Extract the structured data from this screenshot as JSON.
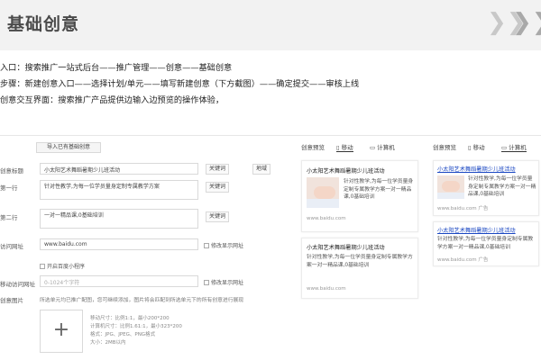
{
  "header": {
    "title": "基础创意"
  },
  "intro": {
    "entry": "入口：搜索推广一站式后台——推广管理——创意——基础创意",
    "steps": "步骤：新建创意入口——选择计划/单元——填写新建创意（下方截图）——确定提交——审核上线",
    "interface": "创意交互界面：搜索推广产品提供边输入边预览的操作体验，"
  },
  "form": {
    "import_button": "导入已有基础创意",
    "title_label": "创意标题",
    "title_value": "小太阳艺术舞蹈暑期少儿班活动",
    "line1_label": "第一行",
    "line1_value": "针对性教学,为每一位学员量身定制专属教学方案",
    "line2_label": "第二行",
    "line2_value": "一对一精品课,0基础培训",
    "visit_url_label": "访问网址",
    "visit_url_value": "www.baidu.com",
    "mobile_landing_checkbox": "开启百度小程序",
    "mobile_url_label": "移动访问网址",
    "mobile_url_placeholder": "0-1024个字符",
    "image_label": "创意图片",
    "image_hint": "所选单元均已推广配图，您可继续添加，图片将会匹配到所选单元下的所有创意进行展现",
    "keyword_button": "关键词",
    "region_button": "地域",
    "modify_display_url": "修改显示网址",
    "upload_icon": "plus-icon",
    "specs": [
      "移动尺寸：比例1:1，最小200*200",
      "计算机尺寸：比例1.61:1，最小323*200",
      "格式：JPG、JPEG、PNG格式",
      "大小：2MB以内"
    ]
  },
  "preview_left": {
    "label": "创意预览",
    "tab_mobile": "移动",
    "tab_pc": "计算机",
    "card1": {
      "title": "小太阳艺术舞蹈暑期少儿班活动",
      "desc": "针对性教学,为每一位学员量身定制专属教学方案一对一精品课,0基础培训",
      "url": "www.baidu.com"
    },
    "card2": {
      "title": "小太阳艺术舞蹈暑期少儿班活动",
      "desc": "针对性教学,为每一位学员量身定制专属教学方案一对一精品课,0基础培训",
      "url": "www.baidu.com"
    }
  },
  "preview_right": {
    "label": "创意预览",
    "tab_mobile": "移动",
    "tab_pc": "计算机",
    "card1": {
      "title": "小太阳艺术舞蹈暑期少儿班活动",
      "desc": "针对性教学,为每一位学员量身定制专属教学方案一对一精品课,0基础培训",
      "url": "www.baidu.com",
      "ad": "广告"
    },
    "card2": {
      "title": "小太阳艺术舞蹈暑期少儿班活动",
      "desc": "针对性教学,为每一位学员量身定制专属教学方案一对一精品课,0基础培训",
      "url": "www.baidu.com",
      "ad": "广告"
    }
  },
  "colors": {
    "header_bg": "#f2f2f2",
    "link": "#1a47c2",
    "chevrons": "#c8c8c8"
  }
}
